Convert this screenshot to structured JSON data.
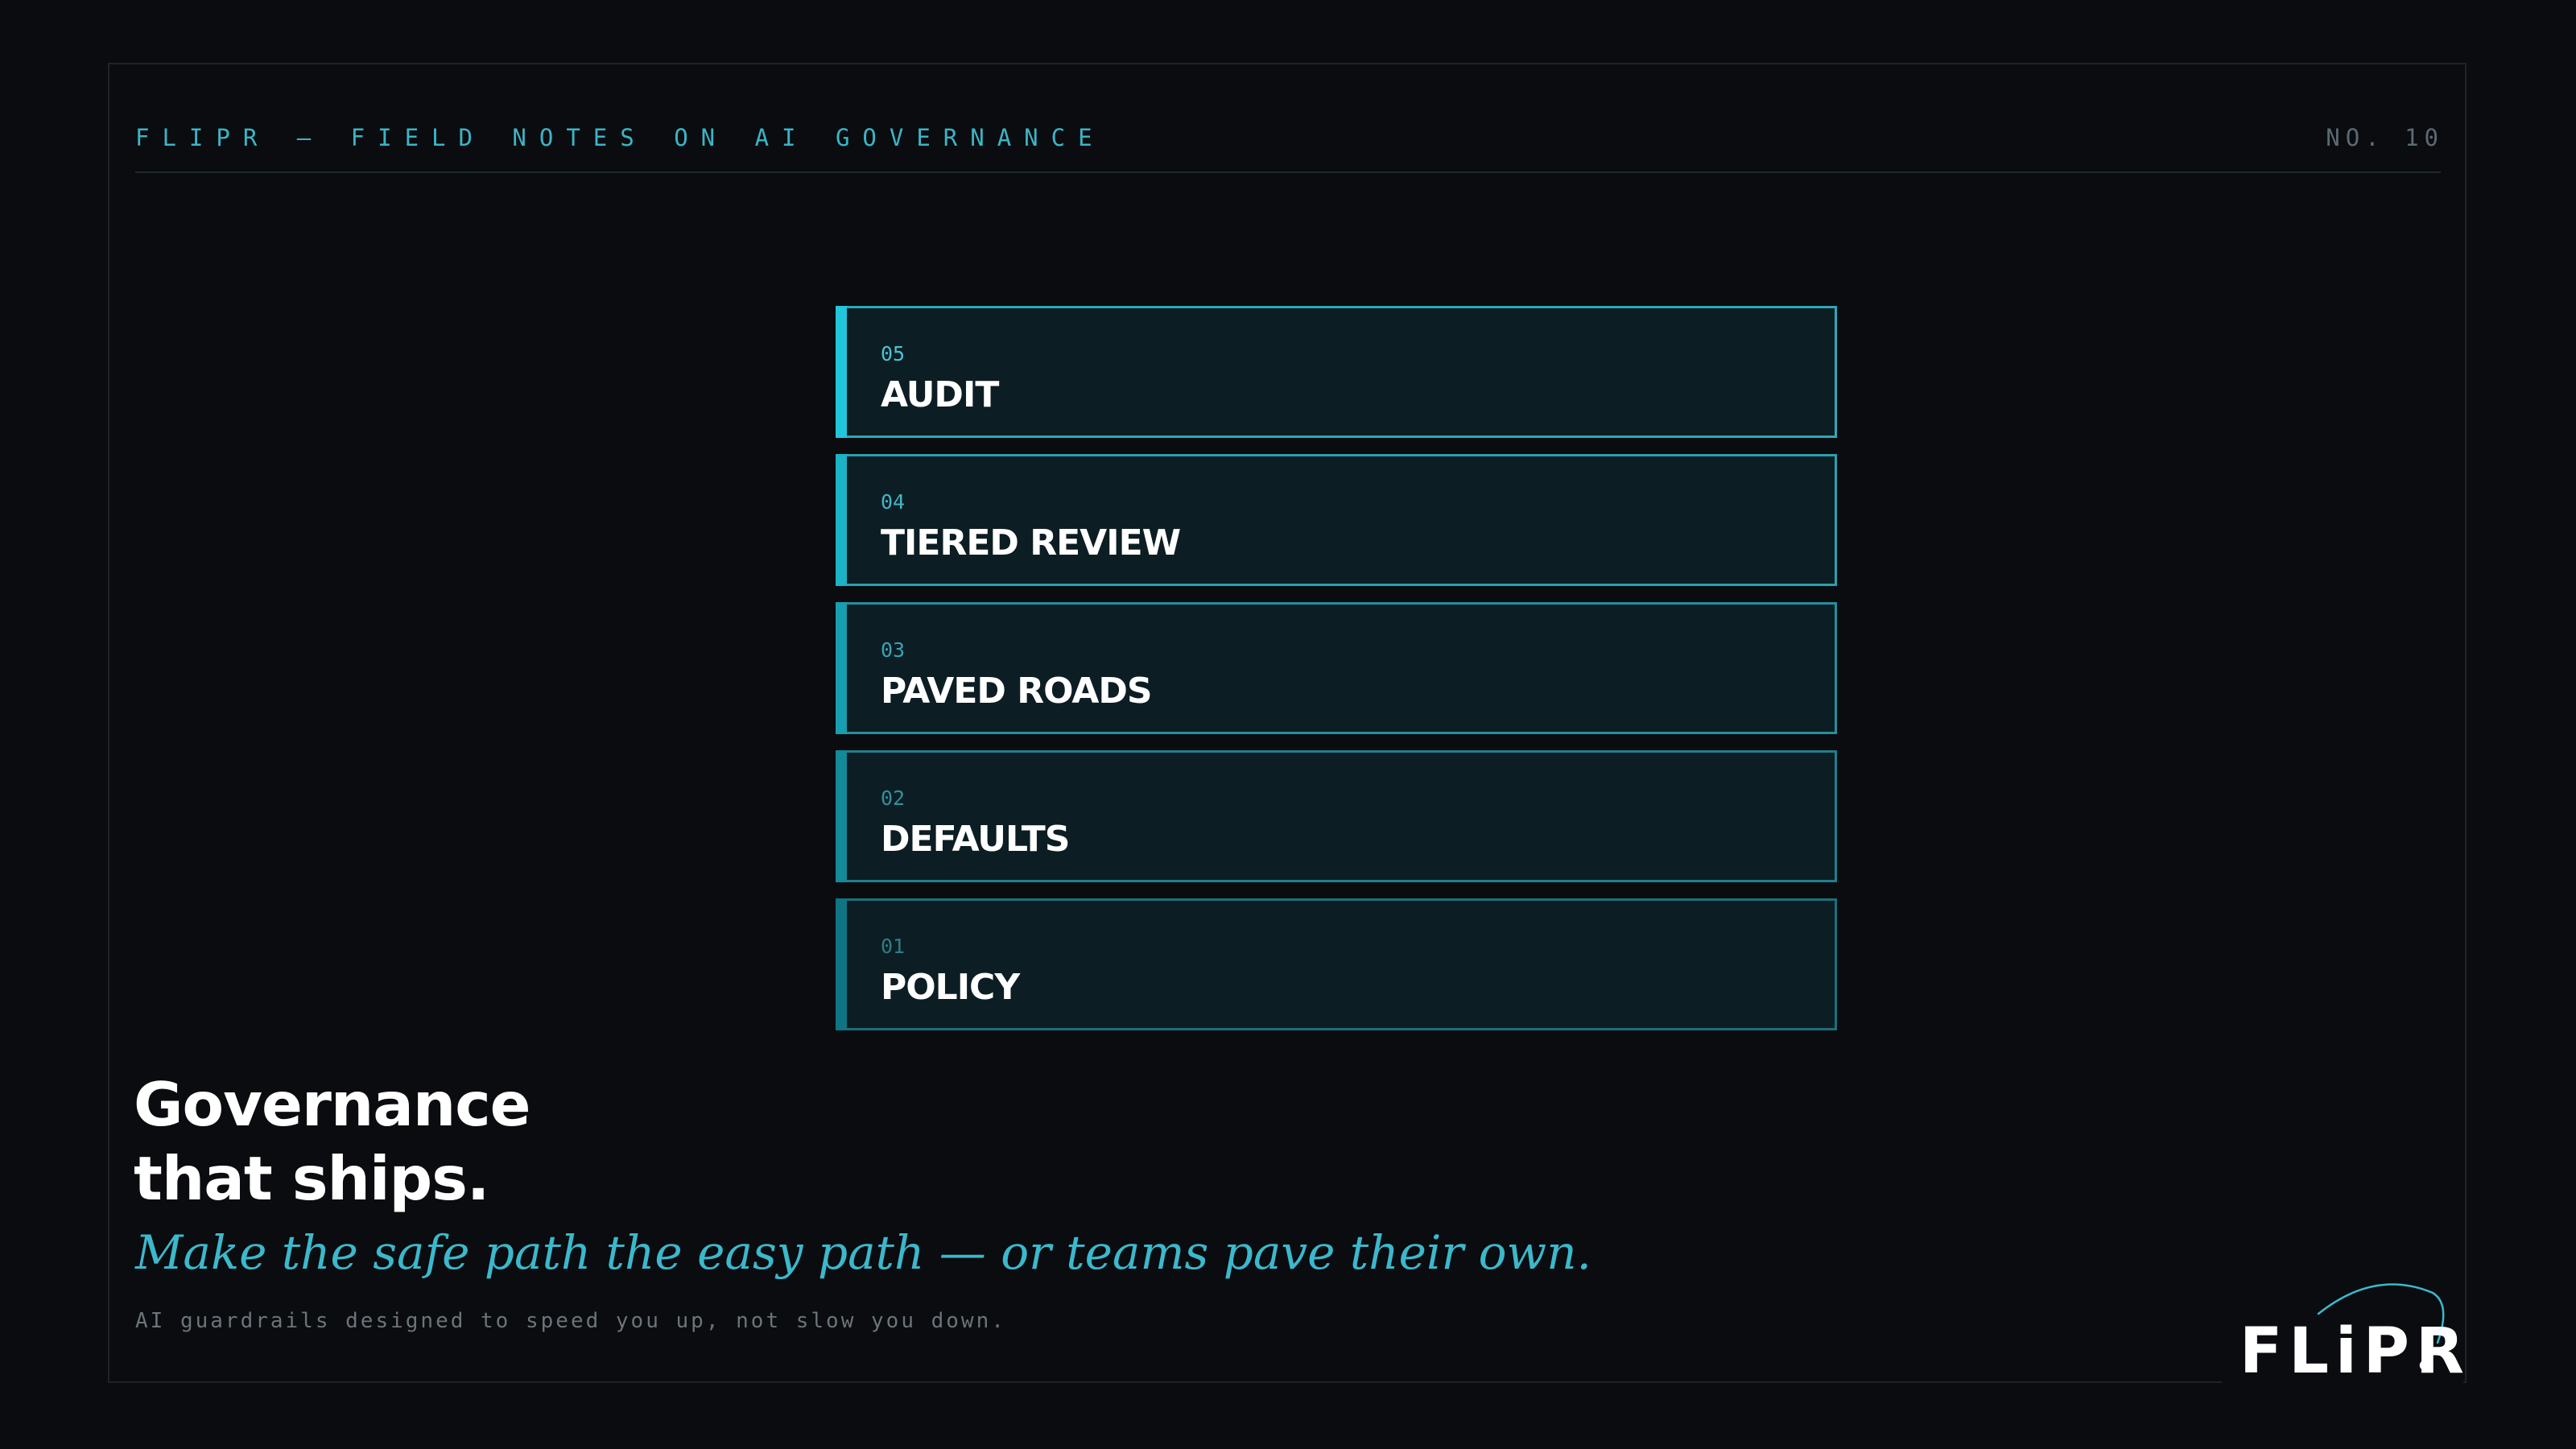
{
  "header": {
    "kicker": "FLIPR — FIELD NOTES ON AI GOVERNANCE",
    "issue": "NO. 10"
  },
  "layers": [
    {
      "number": "05",
      "label": "AUDIT",
      "accent": "#1fc6dc",
      "border": "#2fa7b8",
      "number_color": "#49c3d4"
    },
    {
      "number": "04",
      "label": "TIERED REVIEW",
      "accent": "#1bb3c6",
      "border": "#2b9fb0",
      "number_color": "#43b5c6"
    },
    {
      "number": "03",
      "label": "PAVED ROADS",
      "accent": "#179eb0",
      "border": "#268e9e",
      "number_color": "#3aa3b3"
    },
    {
      "number": "02",
      "label": "DEFAULTS",
      "accent": "#13899a",
      "border": "#217f8e",
      "number_color": "#348f9d"
    },
    {
      "number": "01",
      "label": "POLICY",
      "accent": "#0f7584",
      "border": "#1c6f7c",
      "number_color": "#2e7c88"
    }
  ],
  "headline": {
    "line1": "Governance",
    "line2": "that ships."
  },
  "tagline": "Make the safe path the easy path — or teams pave their own.",
  "subline": "AI guardrails designed to speed you up, not slow you down.",
  "logo": {
    "text": "FLiPR",
    "color": "#ffffff"
  },
  "colors": {
    "background": "#0a0c0f",
    "accent": "#3bb8cc",
    "frame": "#1e2428"
  }
}
